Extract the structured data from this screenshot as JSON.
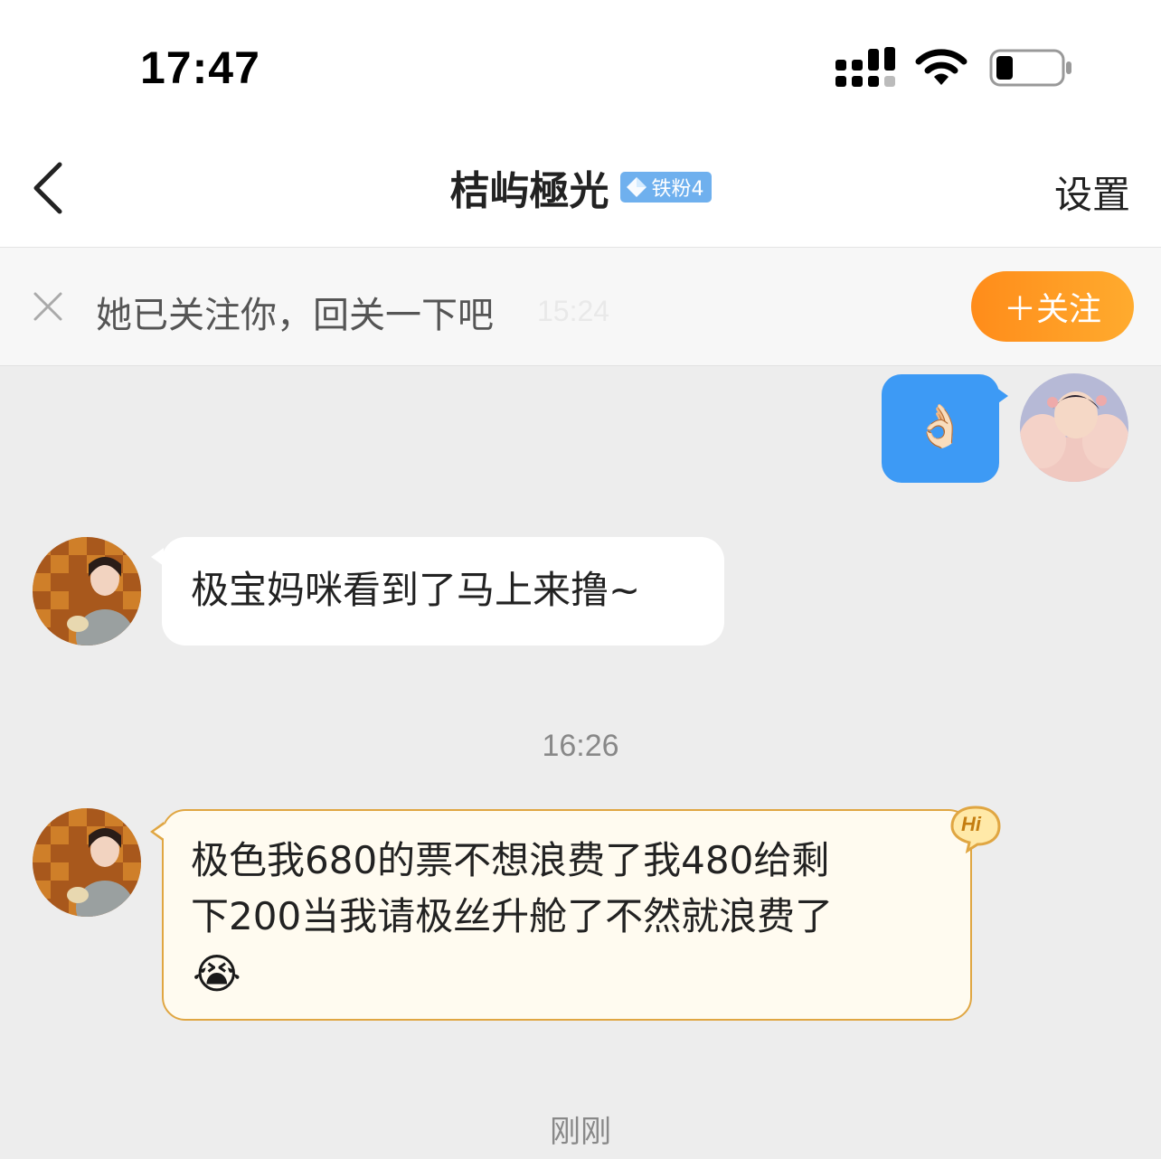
{
  "status_bar": {
    "time": "17:47"
  },
  "nav": {
    "title": "桔屿極光",
    "fan_badge": "铁粉4",
    "settings_label": "设置"
  },
  "follow_prompt": {
    "text": "她已关注你，回关一下吧",
    "time": "15:24",
    "button_label": "＋关注"
  },
  "messages": [
    {
      "sender": "me",
      "type": "emoji",
      "content": "👌🏻"
    },
    {
      "sender": "them",
      "type": "text",
      "content": "极宝妈咪看到了马上来撸~"
    },
    {
      "type": "timestamp",
      "content": "16:26"
    },
    {
      "sender": "them",
      "type": "text",
      "style": "hi-bubble",
      "lines": [
        "极色我680的票不想浪费了我480给剩",
        "下200当我请极丝升舱了不然就浪费了",
        "😭"
      ],
      "badge": "Hi"
    },
    {
      "type": "timestamp",
      "content": "刚刚"
    }
  ],
  "colors": {
    "accent_blue": "#3d9af5",
    "follow_orange": "#ff8c1a",
    "fan_badge_blue": "#6fb0ee",
    "hi_bubble_border": "#e0a642"
  }
}
